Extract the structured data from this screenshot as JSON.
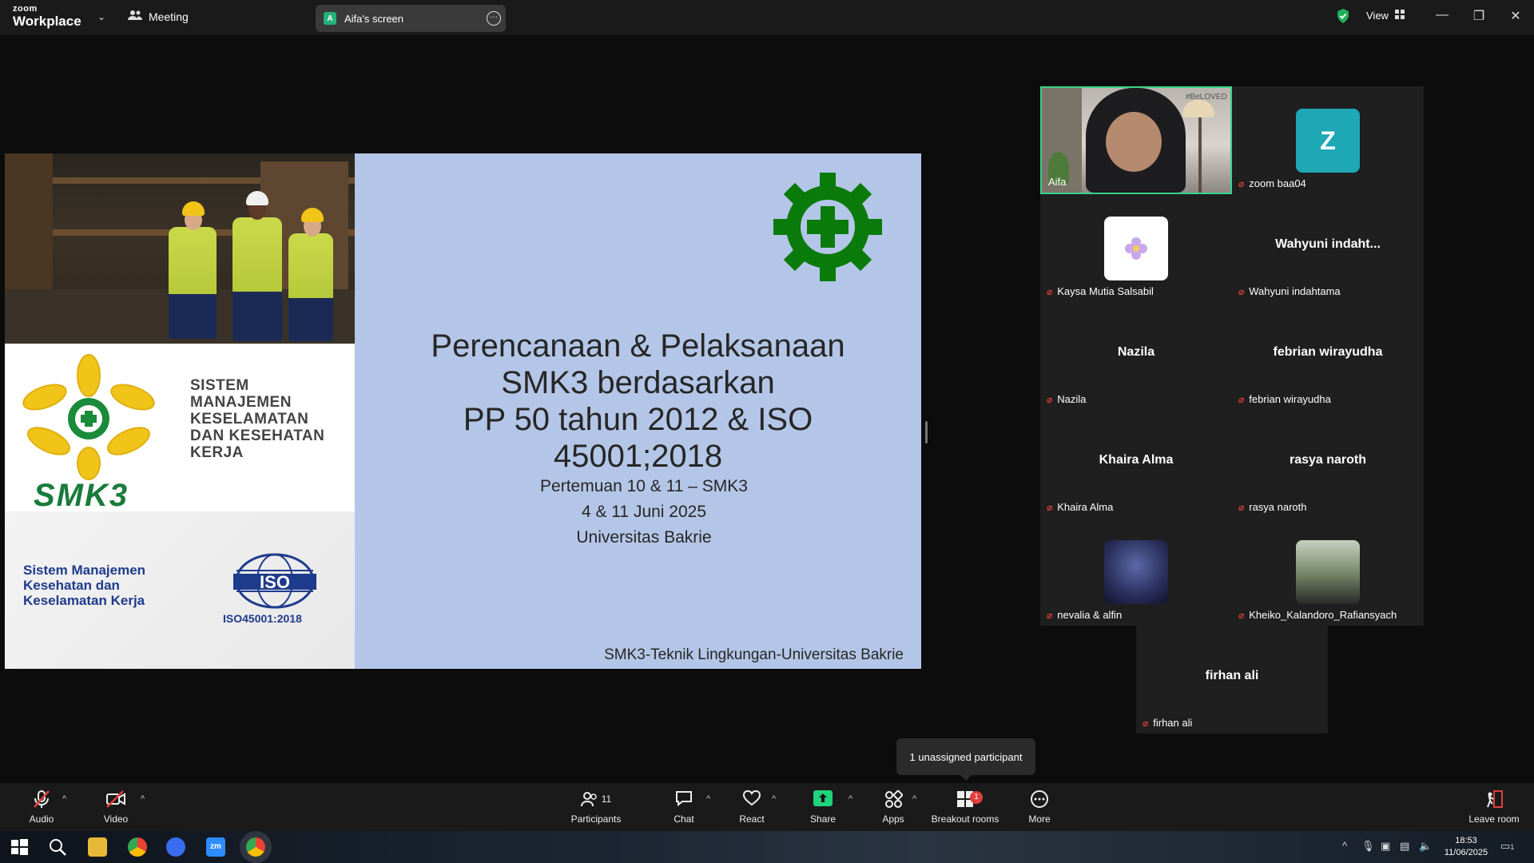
{
  "app": {
    "brand_top": "zoom",
    "brand_bottom": "Workplace",
    "meeting_label": "Meeting",
    "shared_screen_label": "Aifa's screen",
    "shared_screen_initial": "A",
    "view_label": "View"
  },
  "slide": {
    "smk3_caption": [
      "SISTEM",
      "MANAJEMEN",
      "KESELAMATAN",
      "DAN KESEHATAN",
      "KERJA"
    ],
    "smk3_word": "SMK3",
    "iso_caption": [
      "Sistem Manajemen",
      "Kesehatan dan",
      "Keselamatan Kerja"
    ],
    "iso_logo_text": "ISO",
    "iso_sub": "ISO45001:2018",
    "title_lines": [
      "Perencanaan & Pelaksanaan",
      "SMK3 berdasarkan",
      "PP 50 tahun 2012 & ISO",
      "45001;2018"
    ],
    "sub_lines": [
      "Pertemuan 10 & 11 – SMK3",
      "4 & 11 Juni 2025",
      "Universitas Bakrie"
    ],
    "footer": "SMK3-Teknik Lingkungan-Universitas Bakrie",
    "photo_tag": "#BeLOVED"
  },
  "participants": [
    {
      "name": "Aifa",
      "display": "",
      "type": "video",
      "active": true
    },
    {
      "name": "zoom baa04",
      "display": "Z",
      "type": "avatar",
      "color": "#1ea7b5"
    },
    {
      "name": "Kaysa Mutia Salsabil",
      "display": "",
      "type": "avatar-image",
      "color": "#ffffff"
    },
    {
      "name": "Wahyuni indahtama",
      "display": "Wahyuni  indaht...",
      "type": "name"
    },
    {
      "name": "Nazila",
      "display": "Nazila",
      "type": "name"
    },
    {
      "name": "febrian wirayudha",
      "display": "febrian wirayudha",
      "type": "name"
    },
    {
      "name": "Khaira Alma",
      "display": "Khaira Alma",
      "type": "name"
    },
    {
      "name": "rasya naroth",
      "display": "rasya naroth",
      "type": "name"
    },
    {
      "name": "nevalia & alfin",
      "display": "",
      "type": "avatar-image",
      "color": "#2a2f5c"
    },
    {
      "name": "Kheiko_Kalandoro_Rafiansyach",
      "display": "",
      "type": "avatar-image",
      "color": "#7a8a6a"
    },
    {
      "name": "firhan ali",
      "display": "firhan ali",
      "type": "name"
    }
  ],
  "tooltip": "1 unassigned participant",
  "toolbar": {
    "audio": "Audio",
    "video": "Video",
    "participants": "Participants",
    "participants_count": "11",
    "chat": "Chat",
    "react": "React",
    "share": "Share",
    "apps": "Apps",
    "breakout": "Breakout rooms",
    "breakout_badge": "1",
    "more": "More",
    "leave": "Leave room"
  },
  "taskbar": {
    "time": "18:53",
    "date": "11/06/2025",
    "notif_count": "1"
  },
  "colors": {
    "accent_green": "#39d38a",
    "slide_bg": "#b4c6e7",
    "gear_green": "#0a7a0a",
    "mic_off": "#e0403a"
  }
}
